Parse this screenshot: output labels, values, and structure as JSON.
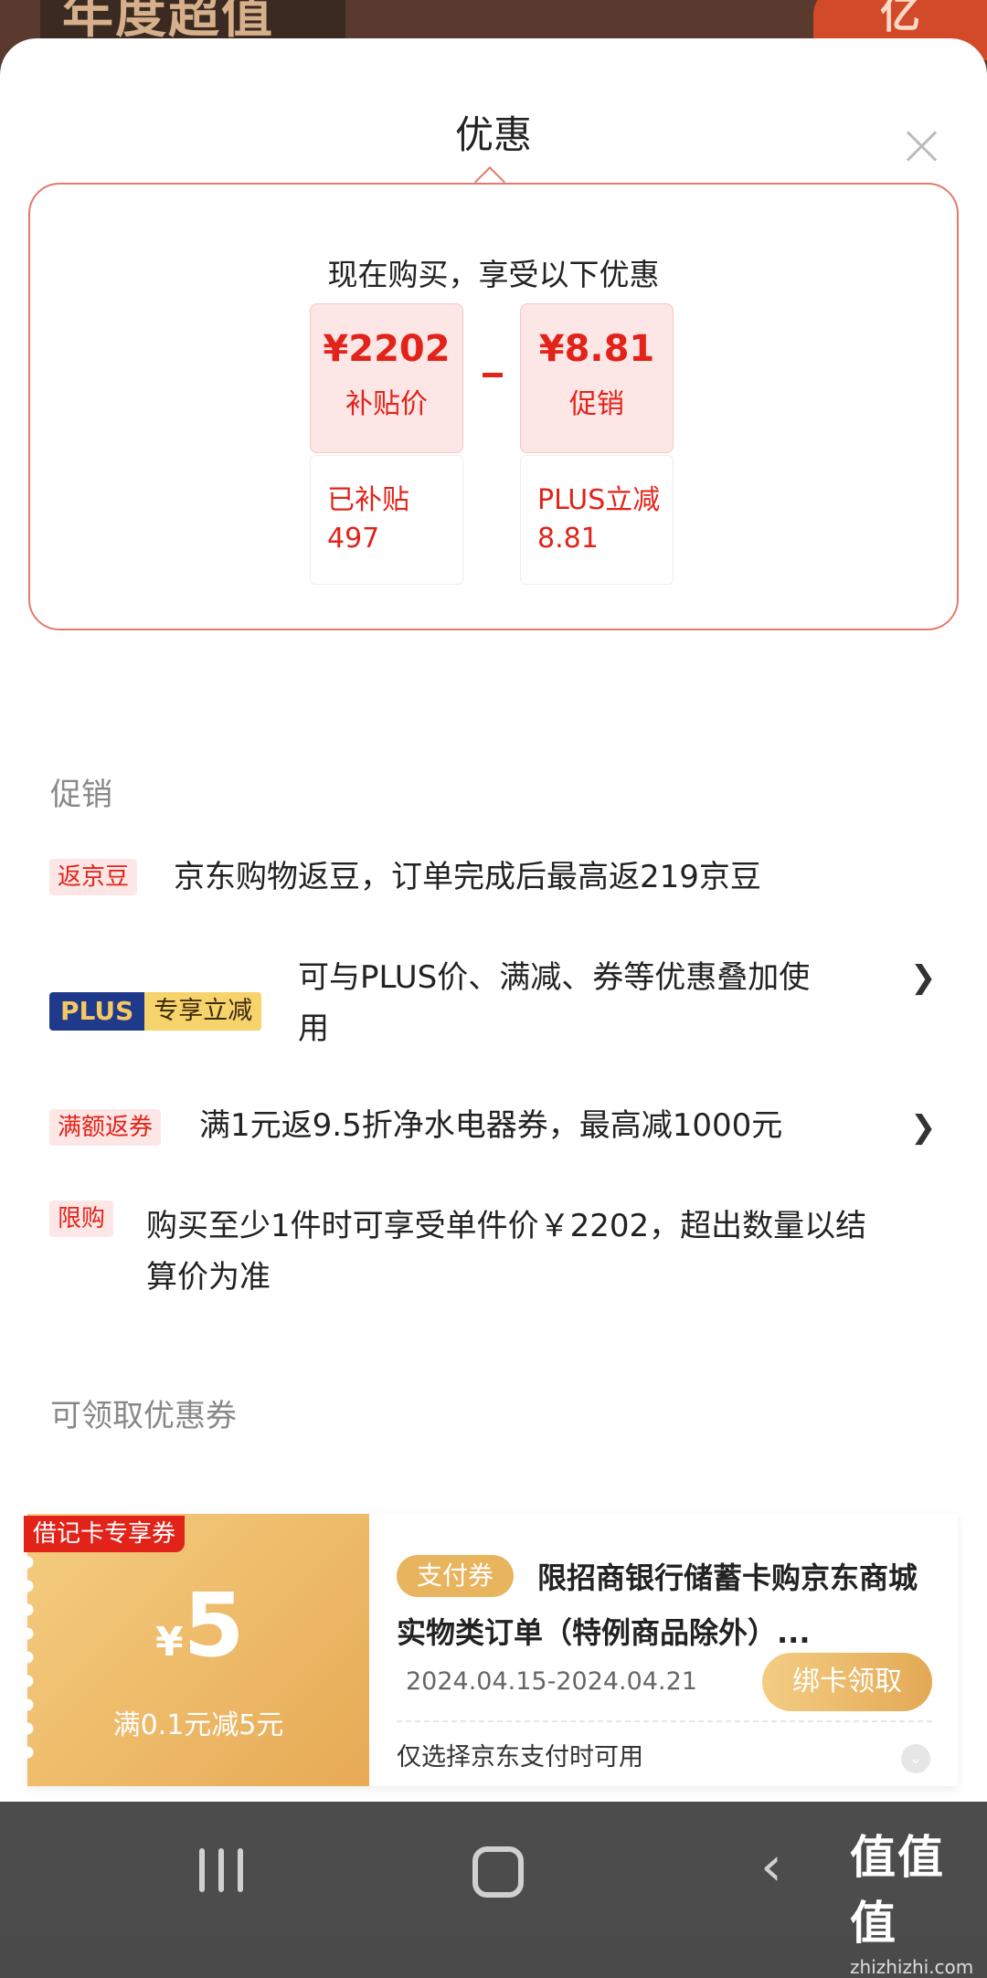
{
  "background_banner": {
    "left_text": "年度超值",
    "right_text": "亿"
  },
  "sheet": {
    "title": "优惠",
    "close_icon": "close-icon"
  },
  "promo": {
    "header": "现在购买，享受以下优惠",
    "subsidy_price": "¥2202",
    "subsidy_label": "补贴价",
    "promo_price": "¥8.81",
    "promo_label": "促销",
    "subsidy_detail_line1": "已补贴",
    "subsidy_detail_line2": "497",
    "plus_detail_line1": "PLUS立减",
    "plus_detail_line2": "8.81"
  },
  "promotions": {
    "section_title": "促销",
    "items": [
      {
        "tag": "返京豆",
        "text": "京东购物返豆，订单完成后最高返219京豆"
      },
      {
        "tag_a": "PLUS",
        "tag_b": "专享立减",
        "text_line1": "可与PLUS价、满减、券等优惠叠加使",
        "text_line2": "用"
      },
      {
        "tag": "满额返券",
        "text": "满1元返9.5折净水电器券，最高减1000元"
      },
      {
        "tag": "限购",
        "text_line1": "购买至少1件时可享受单件价￥2202，超出数量以结",
        "text_line2": "算价为准"
      }
    ]
  },
  "coupons": {
    "section_title": "可领取优惠券",
    "items": [
      {
        "corner_tag": "借记卡专享券",
        "currency": "¥",
        "value": "5",
        "condition": "满0.1元减5元",
        "type_tag": "支付券",
        "title": "限招商银行储蓄卡购京东商城实物类订单（特例商品除外）...",
        "date_range": "2024.04.15-2024.04.21",
        "button": "绑卡领取",
        "note": "仅选择京东支付时可用"
      }
    ]
  },
  "navbar": {
    "watermark": "值值值",
    "watermark_url": "zhizhizhi.com"
  },
  "colors": {
    "accent": "#e2231a",
    "gold": "#e8b45e",
    "plus_blue": "#1f3a8a"
  }
}
